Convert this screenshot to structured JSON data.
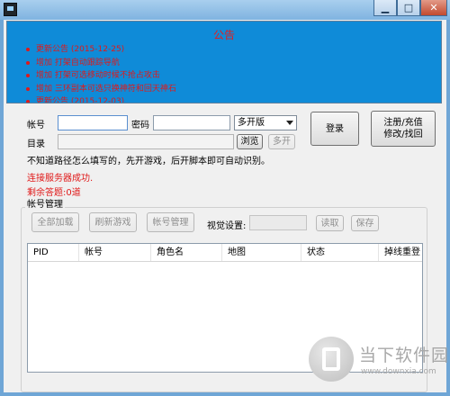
{
  "notice": {
    "title": "公告",
    "items": [
      "更新公告 (2015-12-25)",
      "增加 打架自动跟踪导航",
      "增加 打架可选移动时候不抢占攻击",
      "增加 三环副本可选只换神符和回天神石",
      "更新公告 (2015-12-03)"
    ]
  },
  "login": {
    "account_label": "帐号",
    "account_value": "",
    "password_label": "密码",
    "password_value": "",
    "mode_select": "多开版",
    "login_button": "登录",
    "register_button": "注册/充值\n修改/找回",
    "dir_label": "目录",
    "dir_value": "",
    "browse_button": "浏览",
    "multi_button": "多开"
  },
  "help_text": "不知道路径怎么填写的，先开游戏，后开脚本即可自动识别。",
  "status": {
    "connect": "连接服务器成功.",
    "remaining": "剩余答题:0道"
  },
  "account_mgmt": {
    "title": "帐号管理",
    "load_all_button": "全部加载",
    "refresh_button": "刷新游戏",
    "manage_button": "帐号管理",
    "visual_label": "视觉设置:",
    "visual_value": "",
    "read_button": "读取",
    "save_button": "保存",
    "columns": [
      "PID",
      "帐号",
      "角色名",
      "地图",
      "状态",
      "掉线重登"
    ]
  },
  "watermark": {
    "text": "当下软件园",
    "url": "www.downxia.com"
  }
}
